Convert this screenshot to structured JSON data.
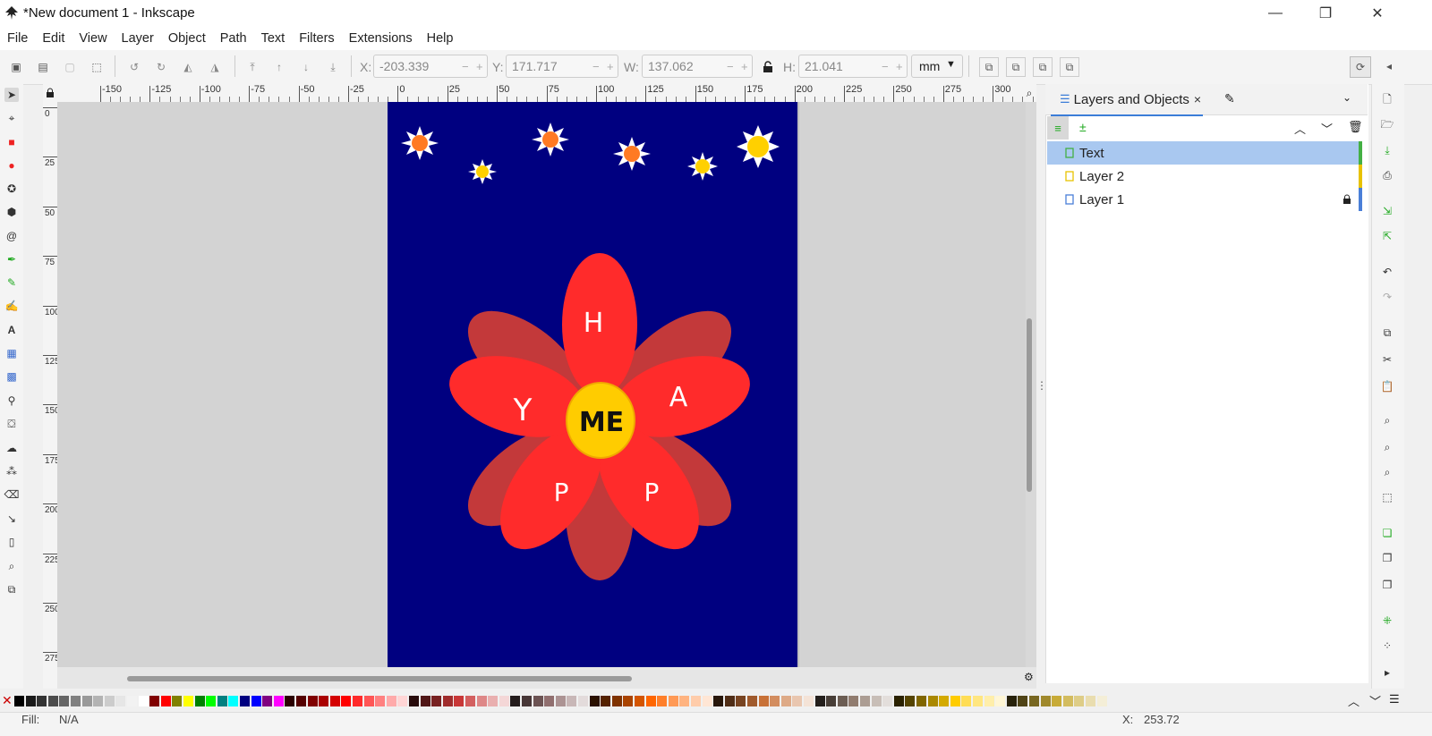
{
  "window": {
    "title": "*New document 1 - Inkscape",
    "minimize": "—",
    "maximize": "❐",
    "close": "✕"
  },
  "menu": [
    "File",
    "Edit",
    "View",
    "Layer",
    "Object",
    "Path",
    "Text",
    "Filters",
    "Extensions",
    "Help"
  ],
  "toolbar": {
    "x_label": "X:",
    "x_value": "-203.339",
    "y_label": "Y:",
    "y_value": "171.717",
    "w_label": "W:",
    "w_value": "137.062",
    "h_label": "H:",
    "h_value": "21.041",
    "unit": "mm"
  },
  "ruler": {
    "h_ticks": [
      "-150",
      "-125",
      "-100",
      "-75",
      "-50",
      "-25",
      "0",
      "25",
      "50",
      "75",
      "100",
      "125",
      "150",
      "175",
      "200",
      "225",
      "250",
      "275",
      "300"
    ],
    "v_ticks": [
      "0",
      "25",
      "50",
      "75",
      "100",
      "125",
      "150",
      "175",
      "200",
      "225",
      "250",
      "275"
    ]
  },
  "drawing": {
    "background_color": "#000080",
    "petal_back_color": "#c3393a",
    "petal_front_color": "#ff2b2b",
    "center_color": "#ffcc00",
    "center_text": "ME",
    "petal_letters": [
      "H",
      "A",
      "P",
      "P",
      "Y"
    ]
  },
  "panel": {
    "tab_title": "Layers and Objects",
    "tab_close": "×",
    "layers": [
      {
        "name": "Text",
        "selected": true,
        "color": "#44b044",
        "locked": false
      },
      {
        "name": "Layer 2",
        "selected": false,
        "color": "#e8c200",
        "locked": false
      },
      {
        "name": "Layer 1",
        "selected": false,
        "color": "#4a7fd8",
        "locked": true
      }
    ]
  },
  "status": {
    "fill_label": "Fill:",
    "fill_value": "N/A",
    "x_label": "X:",
    "x_value": "253.72"
  },
  "palette_colors": [
    "#000000",
    "#1a1a1a",
    "#333333",
    "#4d4d4d",
    "#666666",
    "#808080",
    "#999999",
    "#b3b3b3",
    "#cccccc",
    "#e6e6e6",
    "#f2f2f2",
    "#ffffff",
    "#800000",
    "#ff0000",
    "#808000",
    "#ffff00",
    "#008000",
    "#00ff00",
    "#008080",
    "#00ffff",
    "#000080",
    "#0000ff",
    "#800080",
    "#ff00ff",
    "#2b0000",
    "#550000",
    "#800000",
    "#aa0000",
    "#d40000",
    "#ff0000",
    "#ff2a2a",
    "#ff5555",
    "#ff8080",
    "#ffaaaa",
    "#ffd5d5",
    "#280b0b",
    "#501616",
    "#782121",
    "#a02c2c",
    "#c83737",
    "#d35f5f",
    "#de8787",
    "#e9afaf",
    "#f4d7d7",
    "#241c1c",
    "#483737",
    "#6c5353",
    "#916f6f",
    "#ac9393",
    "#c8b7b7",
    "#e3dbdb",
    "#2b1100",
    "#552200",
    "#803300",
    "#aa4400",
    "#d45500",
    "#ff6600",
    "#ff7f2a",
    "#ff9955",
    "#ffb380",
    "#ffccaa",
    "#ffe6d5",
    "#28170b",
    "#502d16",
    "#784421",
    "#a05a2c",
    "#c87137",
    "#d38d5f",
    "#deaa87",
    "#e9c6af",
    "#f4e3d7",
    "#241f1c",
    "#483e37",
    "#6c5d53",
    "#917c6f",
    "#ac9d93",
    "#c8beb7",
    "#e3dedb",
    "#2b2200",
    "#554400",
    "#806600",
    "#aa8800",
    "#d4aa00",
    "#ffcc00",
    "#ffdd55",
    "#ffe680",
    "#ffeeaa",
    "#fff6d5",
    "#28220b",
    "#504416",
    "#786721",
    "#a0892c",
    "#c8ab37",
    "#d3bc5f",
    "#decd87",
    "#e9ddaf",
    "#f4eed7"
  ]
}
